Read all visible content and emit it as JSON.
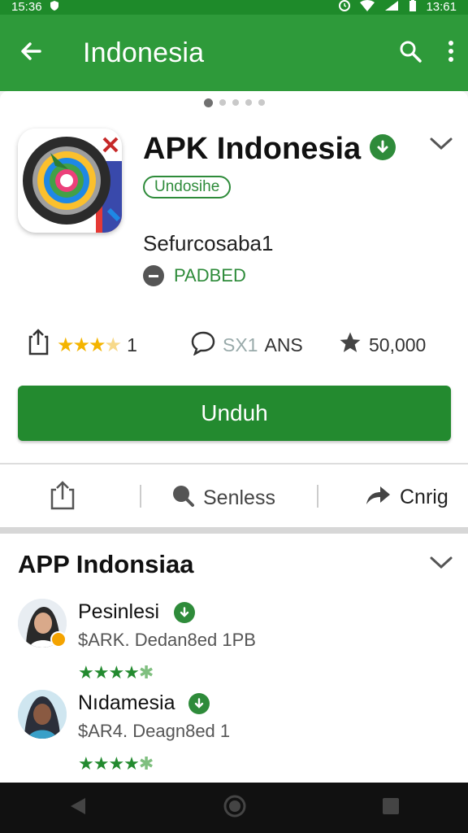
{
  "status_bar": {
    "time_left": "15:36",
    "time_right": "13:61"
  },
  "app_bar": {
    "title": "Indonesia",
    "icons": [
      "back-arrow-icon",
      "search-icon",
      "more-vert-icon"
    ]
  },
  "app": {
    "name": "APK Indonesia",
    "chip": "Undosihe",
    "subtitle": "Sefurcosaba1",
    "status": "PADBED",
    "stats": {
      "rating_count": "1",
      "reviews_prefix": "SX1",
      "reviews_suffix": "ANS",
      "downloads": "50,000"
    },
    "install_label": "Unduh"
  },
  "actions": {
    "share": "",
    "search": "Senless",
    "send": "Cnrig"
  },
  "section": {
    "title": "APP Indonsiaa",
    "items": [
      {
        "name": "Pesinlesi",
        "size": "$ARK. Dedan8ed 1PB"
      },
      {
        "name": "Nıdamesia",
        "size": "$AR4. Deagn8ed 1"
      }
    ]
  },
  "colors": {
    "primary": "#2e9a3a",
    "install": "#238a2f",
    "status_bar": "#1e8a2a"
  }
}
